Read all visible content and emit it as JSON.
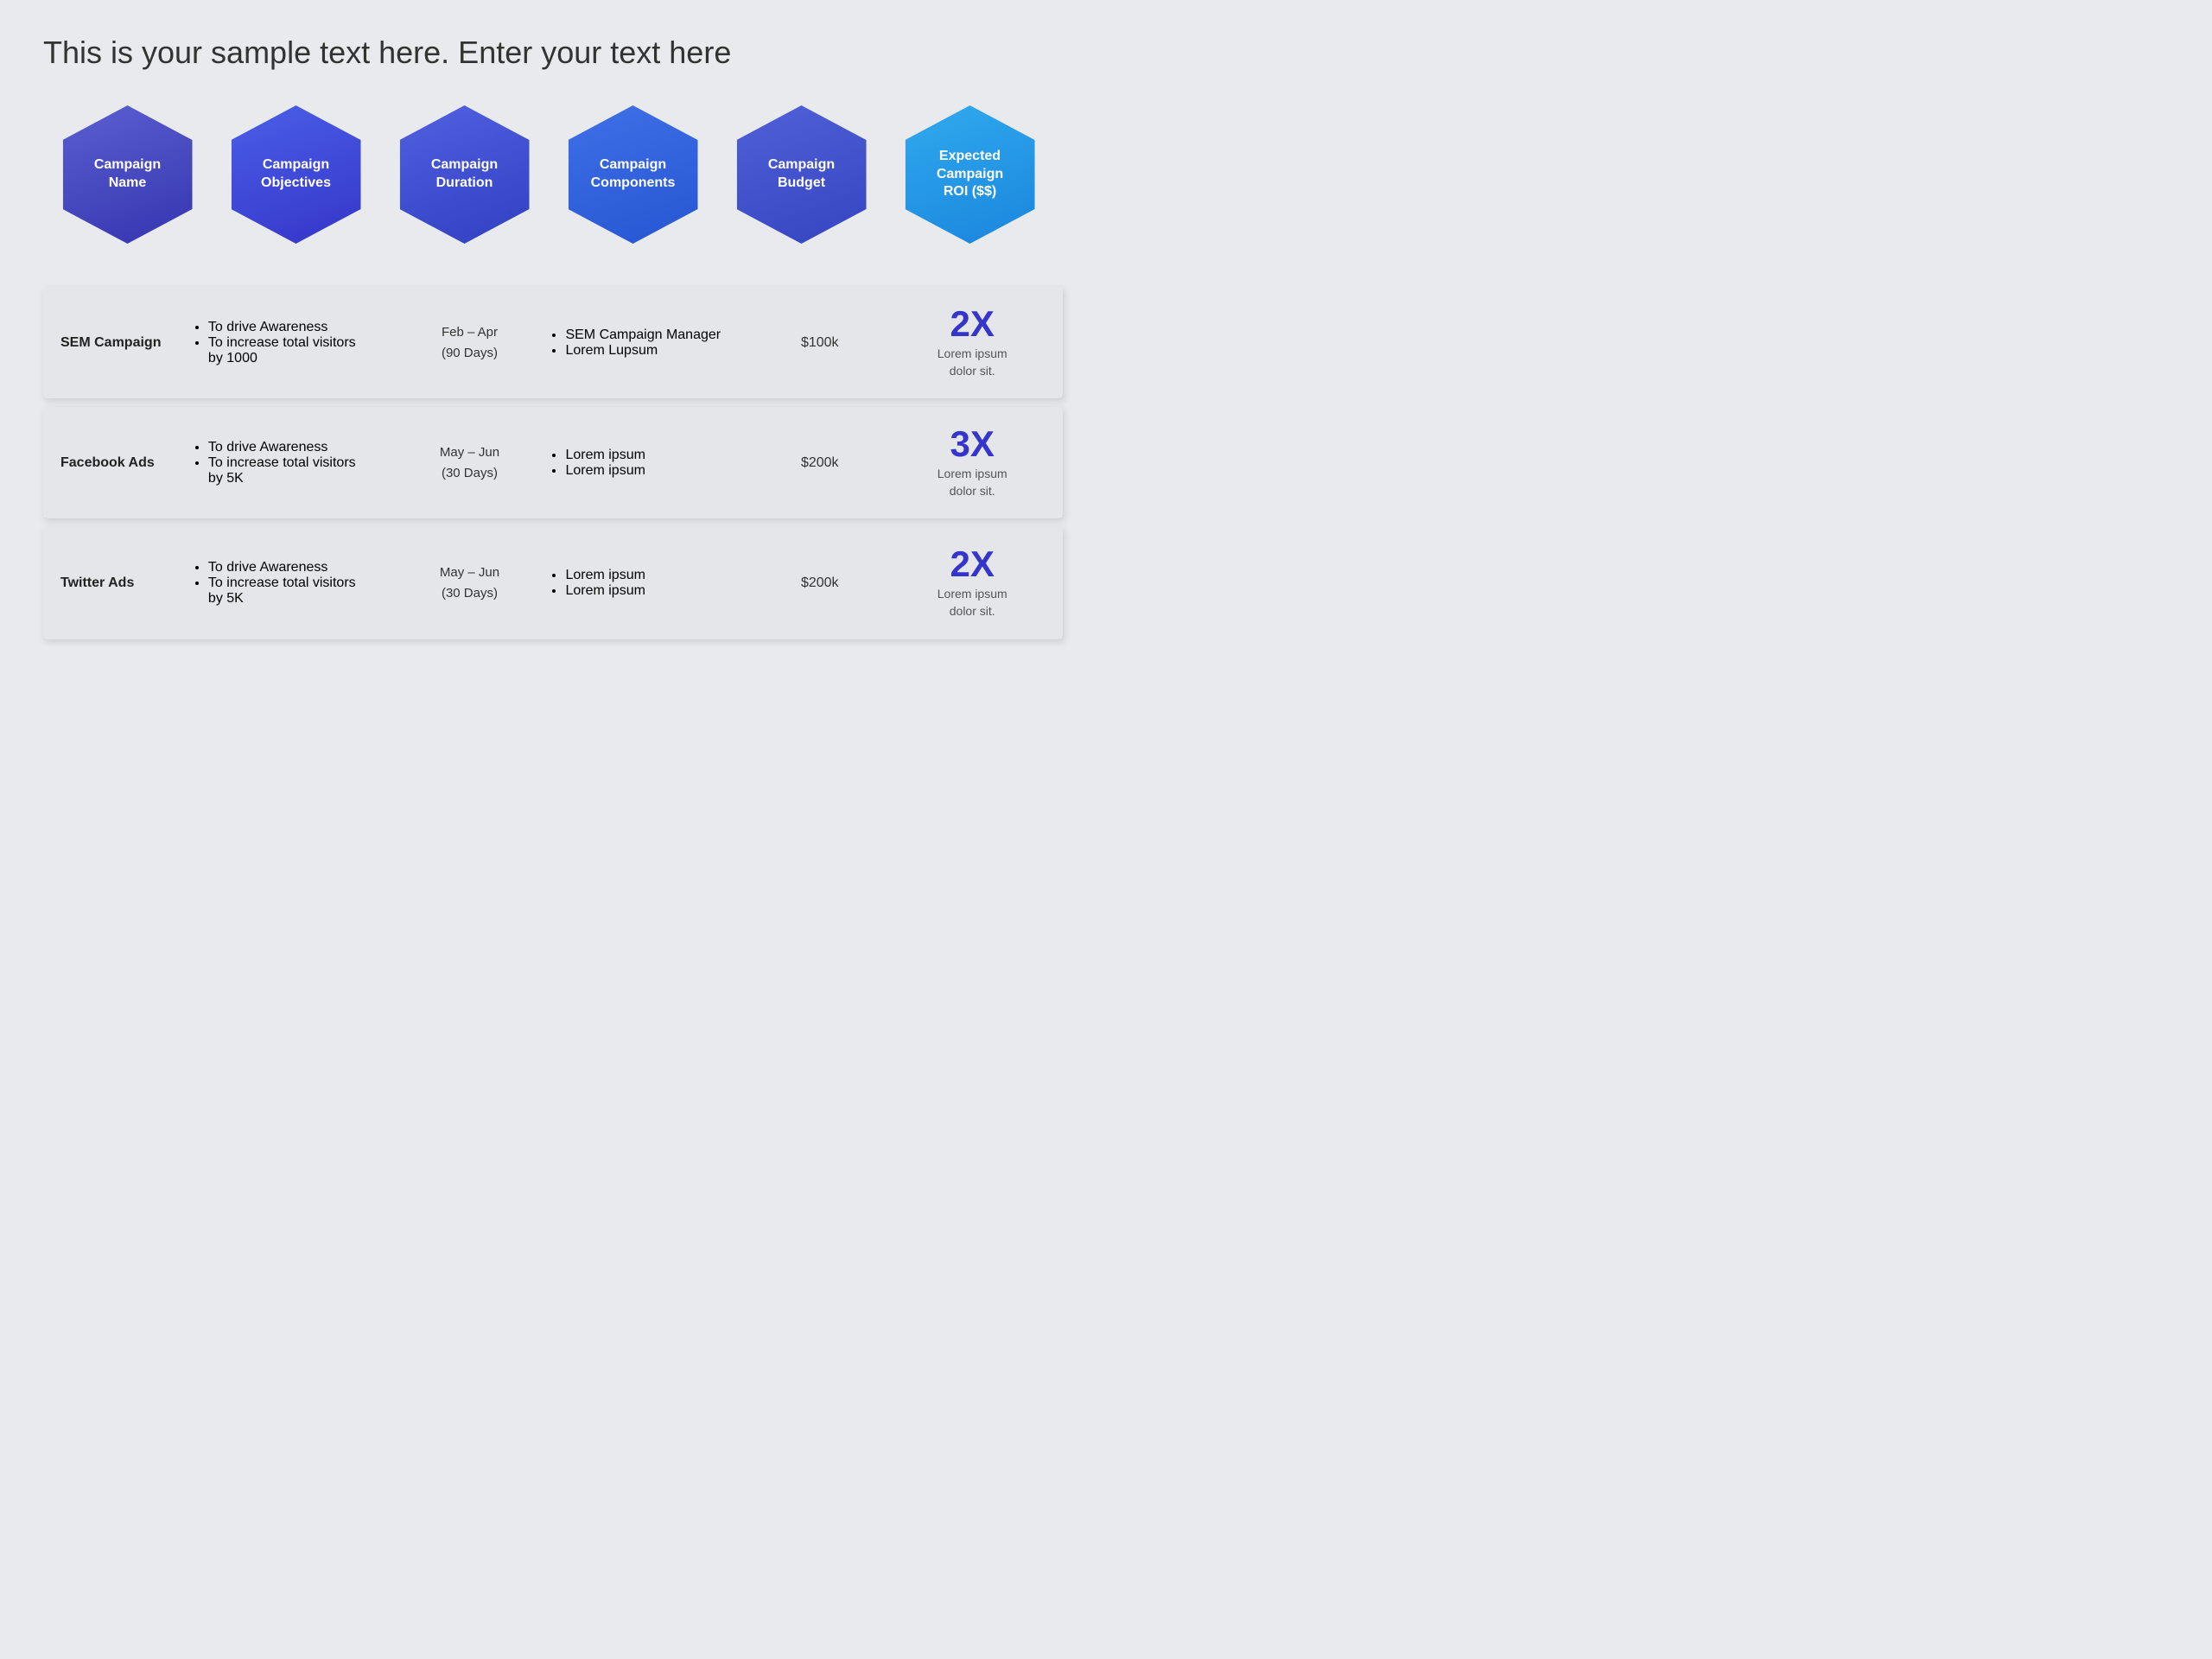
{
  "title": "This is your sample text here. Enter your text here",
  "headers": [
    {
      "id": "h1",
      "label": "Campaign\nName",
      "hex_class": "hex-1"
    },
    {
      "id": "h2",
      "label": "Campaign\nObjectives",
      "hex_class": "hex-2"
    },
    {
      "id": "h3",
      "label": "Campaign\nDuration",
      "hex_class": "hex-3"
    },
    {
      "id": "h4",
      "label": "Campaign\nComponents",
      "hex_class": "hex-4"
    },
    {
      "id": "h5",
      "label": "Campaign\nBudget",
      "hex_class": "hex-5"
    },
    {
      "id": "h6",
      "label": "Expected\nCampaign\nROI ($$)",
      "hex_class": "hex-6"
    }
  ],
  "rows": [
    {
      "id": "row-sem",
      "name": "SEM Campaign",
      "objectives": [
        "To drive Awareness",
        "To increase total visitors by 1000"
      ],
      "duration_line1": "Feb – Apr",
      "duration_line2": "(90 Days)",
      "components": [
        "SEM Campaign Manager",
        "Lorem Lupsum"
      ],
      "budget": "$100k",
      "roi_value": "2X",
      "roi_desc": "Lorem ipsum\ndolor sit."
    },
    {
      "id": "row-fb",
      "name": "Facebook Ads",
      "objectives": [
        "To drive Awareness",
        "To increase total visitors by 5K"
      ],
      "duration_line1": "May – Jun",
      "duration_line2": "(30 Days)",
      "components": [
        "Lorem ipsum",
        "Lorem ipsum"
      ],
      "budget": "$200k",
      "roi_value": "3X",
      "roi_desc": "Lorem ipsum\ndolor sit."
    },
    {
      "id": "row-tw",
      "name": "Twitter Ads",
      "objectives": [
        "To drive Awareness",
        "To increase total visitors by 5K"
      ],
      "duration_line1": "May – Jun",
      "duration_line2": "(30 Days)",
      "components": [
        "Lorem ipsum",
        "Lorem ipsum"
      ],
      "budget": "$200k",
      "roi_value": "2X",
      "roi_desc": "Lorem ipsum\ndolor sit."
    }
  ]
}
